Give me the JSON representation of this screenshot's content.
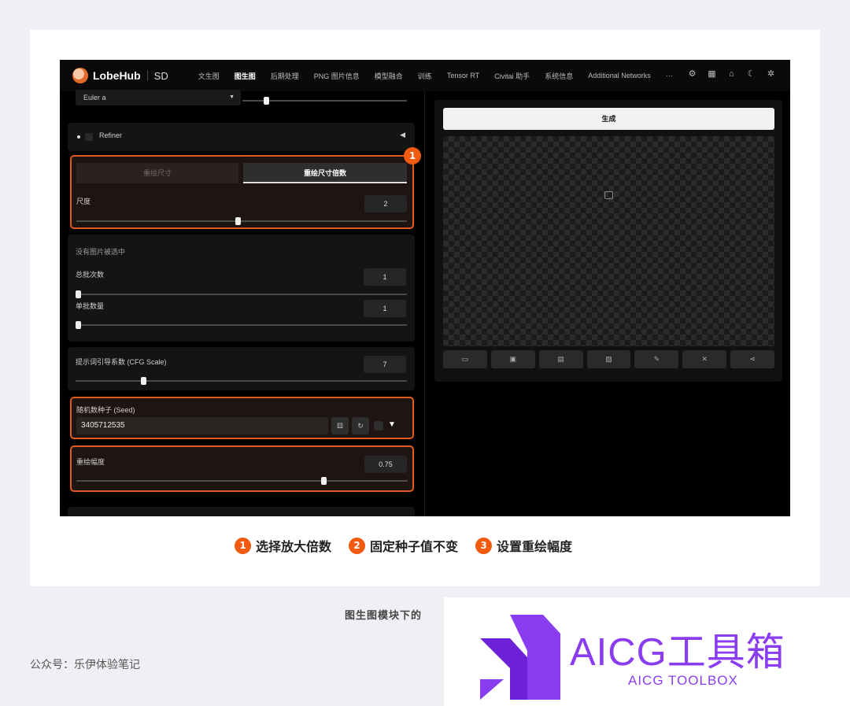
{
  "app": {
    "logo_text": "LobeHub",
    "product": "SD",
    "tabs": [
      "文生图",
      "图生图",
      "后期处理",
      "PNG 图片信息",
      "模型融合",
      "训练",
      "Tensor RT",
      "Civitai 助手",
      "系统信息",
      "Additional Networks",
      "···"
    ],
    "active_tab": "图生图",
    "header_icons": [
      "gear-icon",
      "grid-icon",
      "github-icon",
      "moon-icon",
      "settings-icon"
    ]
  },
  "left": {
    "sampler_value": "Euler a",
    "refiner_label": "Refiner",
    "resize_tabs": {
      "by_size": "重绘尺寸",
      "by_scale": "重绘尺寸倍数"
    },
    "scale": {
      "label": "尺度",
      "value": "2",
      "fraction": 0.49
    },
    "no_image": "没有图片被选中",
    "batch_count": {
      "label": "总批次数",
      "value": "1",
      "fraction": 0.0
    },
    "batch_size": {
      "label": "单批数量",
      "value": "1",
      "fraction": 0.0
    },
    "cfg": {
      "label": "提示词引导系数 (CFG Scale)",
      "value": "7",
      "fraction": 0.2
    },
    "seed": {
      "label": "随机数种子 (Seed)",
      "value": "3405712535"
    },
    "denoise": {
      "label": "重绘幅度",
      "value": "0.75",
      "fraction": 0.75
    }
  },
  "right": {
    "generate_label": "生成",
    "tool_icons": [
      "folder-icon",
      "save-icon",
      "zip-icon",
      "image-icon",
      "brush-icon",
      "tools-icon",
      "share-icon"
    ]
  },
  "badges": {
    "one": "1"
  },
  "steps": [
    {
      "num": "1",
      "text": "选择放大倍数"
    },
    {
      "num": "2",
      "text": "固定种子值不变"
    },
    {
      "num": "3",
      "text": "设置重绘幅度"
    }
  ],
  "caption": "图生图模块下的",
  "source": "公众号：乐伊体验笔记",
  "watermark": {
    "title": "AICG工具箱",
    "subtitle": "AICG TOOLBOX"
  },
  "colors": {
    "accent": "#f25a10",
    "brand": "#8a3cf0"
  }
}
